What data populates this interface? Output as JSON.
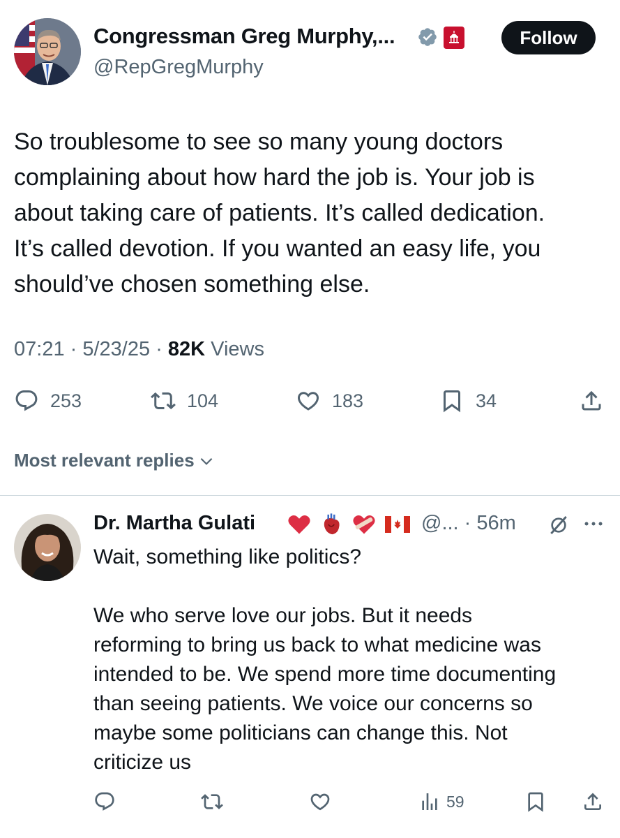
{
  "post": {
    "author_name": "Congressman Greg Murphy,...",
    "author_handle": "@RepGregMurphy",
    "follow_label": "Follow",
    "text_lines": [
      "So troublesome to see so many young doctors",
      "complaining about how hard the job is. Your job is",
      "about taking care of patients. It’s called dedication.",
      "It’s called devotion. If you wanted an easy life, you",
      "should’ve chosen something else."
    ],
    "time": "07:21",
    "date": "5/23/25",
    "views_count": "82K",
    "views_label": "Views",
    "replies": "253",
    "reposts": "104",
    "likes": "183",
    "bookmarks": "34"
  },
  "replies_header": {
    "label": "Most relevant replies"
  },
  "reply": {
    "author_name": "Dr. Martha Gulati",
    "handle_time": "@... · 56m",
    "text_lines": [
      "Wait, something like politics?",
      "",
      "We who serve love our jobs. But it needs",
      "reforming to bring us back to what medicine was",
      "intended to be. We spend more time documenting",
      "than seeing patients. We voice our concerns so",
      "maybe some politicians can change this. Not",
      "criticize us"
    ],
    "views": "59"
  },
  "colors": {
    "text": "#0f1419",
    "secondary": "#536471",
    "verified_badge": "#829aab",
    "gov_badge": "#c8102e",
    "divider": "#cfd9de"
  },
  "icons": {
    "header": [
      "verified-badge-icon",
      "government-affiliation-icon"
    ],
    "post_actions": [
      "reply-icon",
      "repost-icon",
      "like-icon",
      "bookmark-icon",
      "share-icon"
    ],
    "reply_actions": [
      "reply-icon",
      "repost-icon",
      "like-icon",
      "views-icon",
      "bookmark-icon",
      "share-icon"
    ],
    "reply_header": [
      "red-heart-icon",
      "anatomical-heart-icon",
      "mending-heart-icon",
      "canada-flag-icon",
      "grok-icon",
      "more-icon"
    ]
  }
}
